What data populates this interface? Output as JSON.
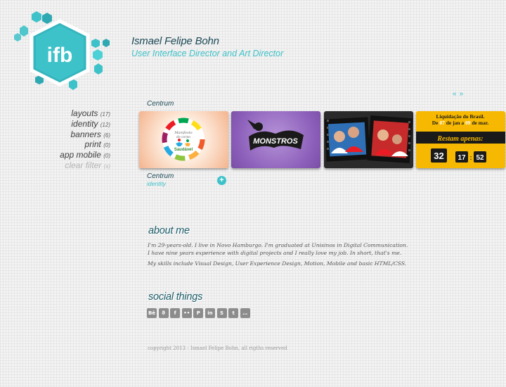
{
  "logo": {
    "text": "ifb"
  },
  "header": {
    "name": "Ismael Felipe Bohn",
    "role": "User Interface Director and Art Director"
  },
  "filters": [
    {
      "label": "layouts",
      "count": "(17)"
    },
    {
      "label": "identity",
      "count": "(12)"
    },
    {
      "label": "banners",
      "count": "(6)"
    },
    {
      "label": "print",
      "count": "(0)"
    },
    {
      "label": "app mobile",
      "count": "(0)"
    },
    {
      "label": "clear filter",
      "count": "(x)"
    }
  ],
  "slider": {
    "prev": "«",
    "next": "»"
  },
  "portfolio": {
    "heading": "Centrum",
    "caption_title": "Centrum",
    "caption_category": "identity",
    "plus": "+"
  },
  "thumbs": {
    "t1": {
      "line1": "Manifesto",
      "line2": "do corpo",
      "line3": "Saudável"
    },
    "t2": {
      "text": "MONSTROS"
    },
    "t4": {
      "line1": "Liquidação do Brasil.",
      "line2_a": "De ",
      "line2_b": "07",
      "line2_c": " de jan a ",
      "line2_d": "09",
      "line2_e": " de mar.",
      "banner": "Restam apenas:",
      "days": "32",
      "hours": "17",
      "minutes": "52"
    }
  },
  "about": {
    "title": "about me",
    "p1": "I'm 29-years-old. I live in Novo Hamburgo. I'm graduated at Unisinos in Digital Communication. I have nine years experience with digital projects and I really love my job. In short, that's me.",
    "p2": "My skills include Visual Design, User Experience Design, Motion, Mobile and basic HTML/CSS."
  },
  "social": {
    "title": "social things",
    "icons": [
      {
        "name": "behance-icon",
        "glyph": "Bē"
      },
      {
        "name": "delicious-icon",
        "glyph": "ϑ"
      },
      {
        "name": "facebook-icon",
        "glyph": "f"
      },
      {
        "name": "flickr-icon",
        "glyph": "••"
      },
      {
        "name": "pinterest-icon",
        "glyph": "P"
      },
      {
        "name": "linkedin-icon",
        "glyph": "in"
      },
      {
        "name": "skype-icon",
        "glyph": "S"
      },
      {
        "name": "twitter-icon",
        "glyph": "t"
      },
      {
        "name": "chat-icon",
        "glyph": "…"
      }
    ]
  },
  "footer": {
    "copyright": "copyright 2013 - Ismael Felipe Bohn, all rigths reserved"
  },
  "colors": {
    "accent": "#3ec2c9",
    "dark": "#1c4a57",
    "banner_yellow": "#f6b800"
  }
}
